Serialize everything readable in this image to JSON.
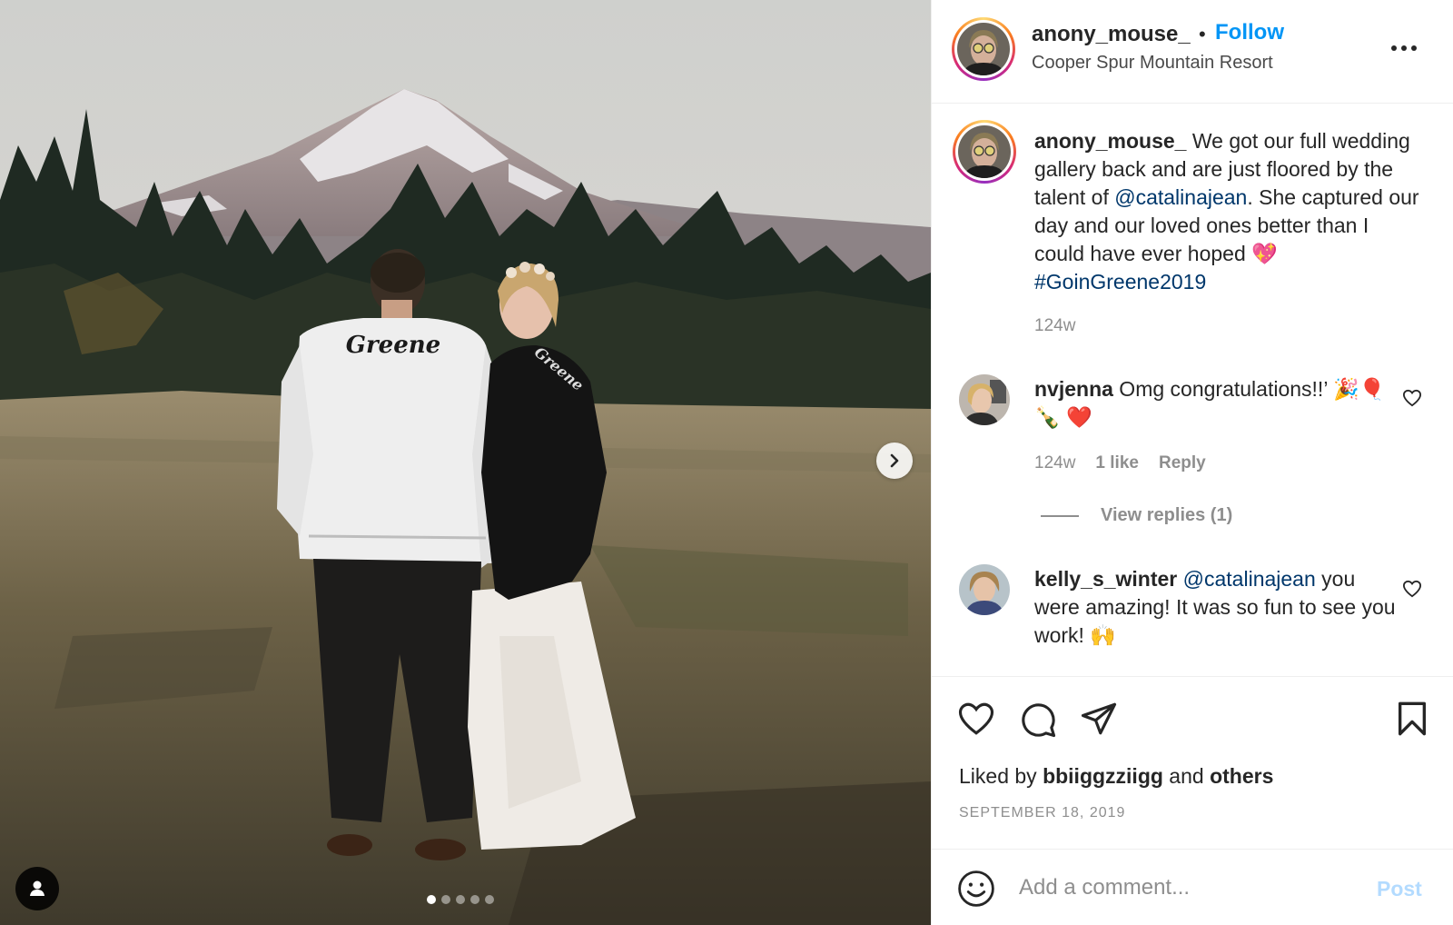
{
  "header": {
    "username": "anony_mouse_",
    "separator": "•",
    "follow_label": "Follow",
    "location": "Cooper Spur Mountain Resort",
    "more_icon": "more-horizontal-icon"
  },
  "caption": {
    "username": "anony_mouse_",
    "text_1": " We got our full wedding gallery back and are just floored by the talent of ",
    "mention": "@catalinajean",
    "text_2": ". She captured our day and our loved ones better than I could have ever hoped ",
    "emoji": "💖",
    "hashtag": "#GoinGreene2019",
    "time": "124w"
  },
  "comments": [
    {
      "username": "nvjenna",
      "text": " Omg congratulations!!’ 🎉🎈🍾 ❤️",
      "time": "124w",
      "likes": "1 like",
      "reply_label": "Reply",
      "view_replies": "View replies (1)"
    },
    {
      "username": "kelly_s_winter",
      "mention": "@catalinajean",
      "text": " you were amazing! It was so fun to see you work! 🙌"
    }
  ],
  "actions": {
    "like_icon": "heart-icon",
    "comment_icon": "comment-icon",
    "share_icon": "share-icon",
    "save_icon": "bookmark-icon"
  },
  "likes": {
    "prefix": "Liked by ",
    "user": "bbiiggzziigg",
    "middle": " and ",
    "others": "others"
  },
  "date": "SEPTEMBER 18, 2019",
  "add_comment": {
    "placeholder": "Add a comment...",
    "post_label": "Post",
    "emoji_icon": "smiley-icon"
  },
  "carousel": {
    "slide_count": 5,
    "active_index": 0,
    "next_icon": "chevron-right-icon",
    "tag_icon": "user-tag-icon"
  },
  "photo": {
    "jacket_text_groom": "Greene",
    "jacket_text_bride": "Greene"
  }
}
